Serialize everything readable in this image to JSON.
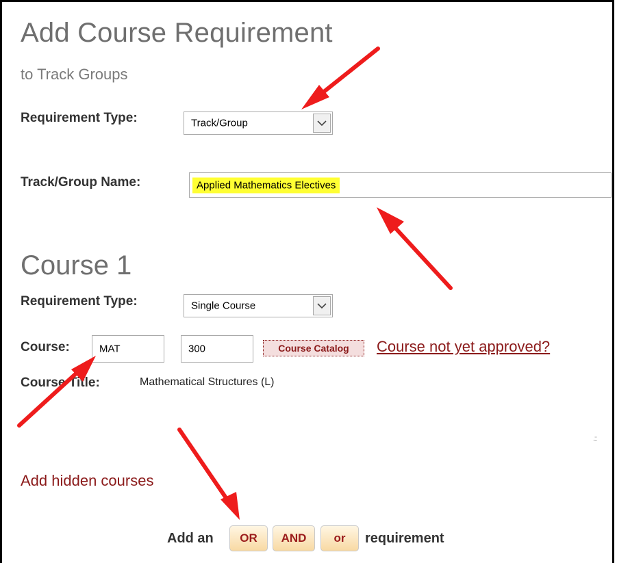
{
  "header": {
    "title": "Add Course Requirement",
    "subtitle": "to Track Groups"
  },
  "track_form": {
    "requirement_type_label": "Requirement Type:",
    "requirement_type_value": "Track/Group",
    "track_group_name_label": "Track/Group Name:",
    "track_group_name_value": "Applied Mathematics Electives"
  },
  "course": {
    "heading": "Course 1",
    "requirement_type_label": "Requirement Type:",
    "requirement_type_value": "Single Course",
    "course_label": "Course:",
    "subject_value": "MAT",
    "number_value": "300",
    "catalog_button": "Course Catalog",
    "not_approved_link": "Course not yet approved?",
    "title_label": "Course Title:",
    "title_value": "Mathematical Structures (L)"
  },
  "hidden_courses_link": "Add hidden courses",
  "add_requirement": {
    "prefix": "Add an",
    "or_upper": "OR",
    "and": "AND",
    "or_lower": "or",
    "suffix": "requirement"
  },
  "colors": {
    "accent": "#8b1a1a",
    "highlight": "#ffff33",
    "annotation_arrow": "#ee1c1c"
  }
}
